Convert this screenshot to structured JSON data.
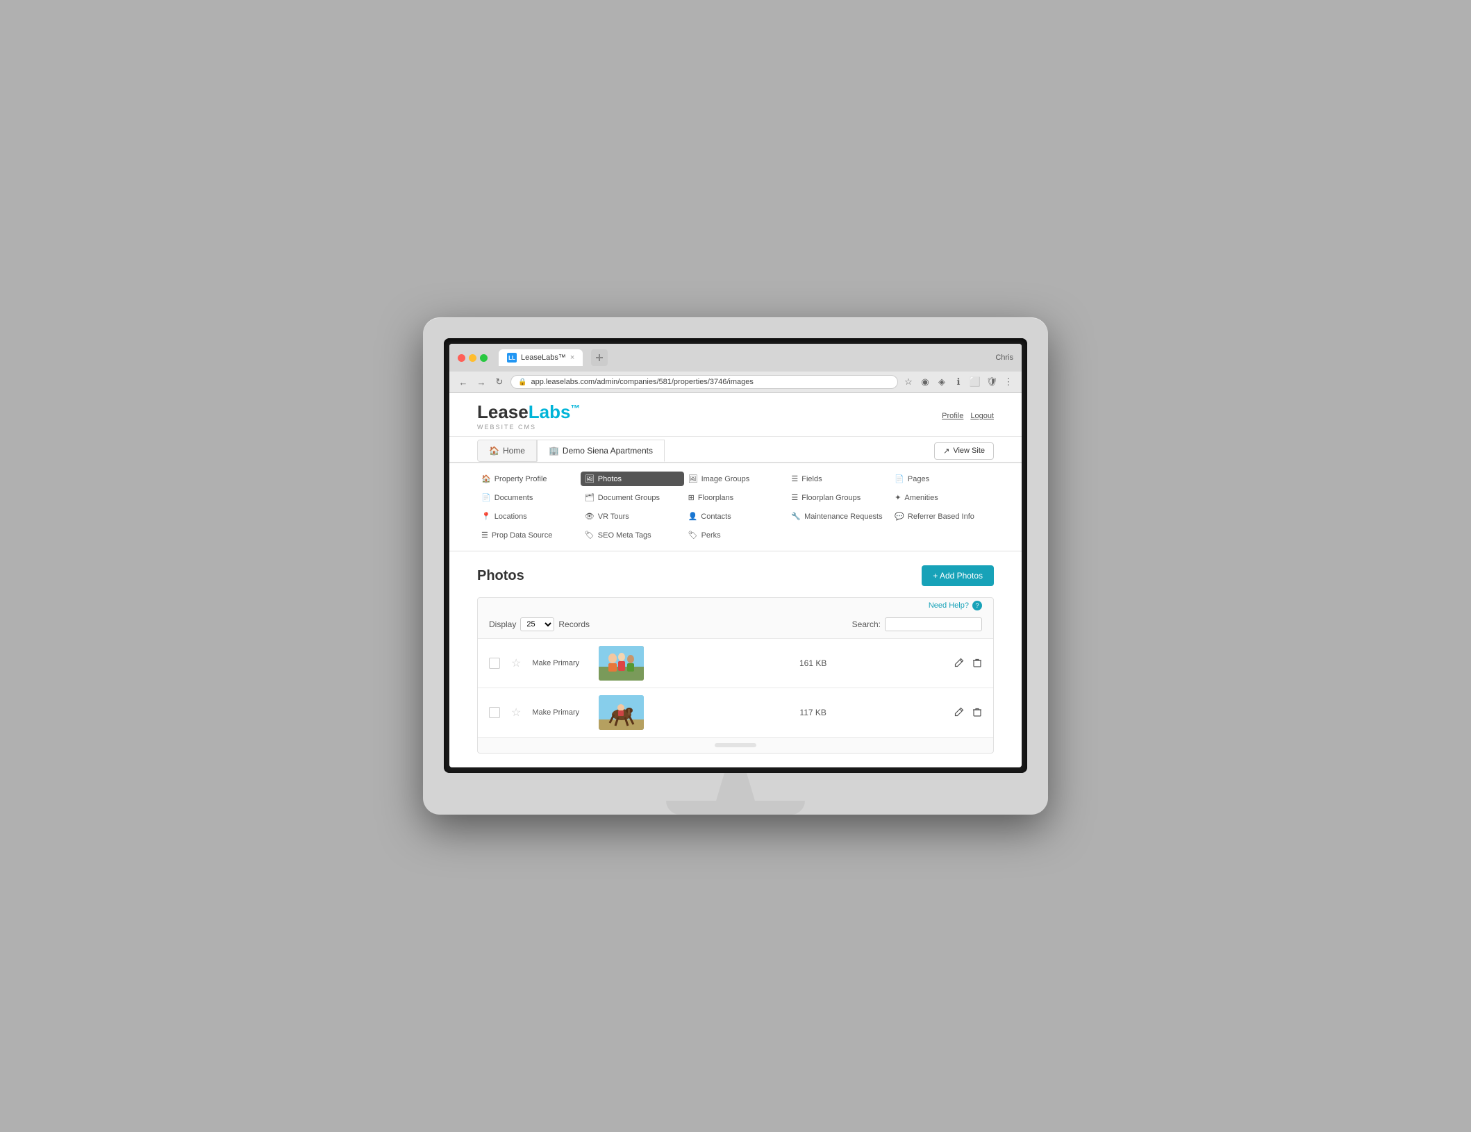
{
  "browser": {
    "tab_title": "LeaseLabs™",
    "tab_close": "×",
    "url": "app.leaselabs.com/admin/companies/581/properties/3746/images",
    "user_label": "Chris"
  },
  "header": {
    "logo_lease": "Lease",
    "logo_labs": "Labs",
    "logo_mark": "™",
    "logo_subtitle": "WEBSITE CMS",
    "nav_profile": "Profile",
    "nav_logout": "Logout"
  },
  "top_tabs": {
    "home_tab": "Home",
    "property_tab": "Demo Siena Apartments",
    "view_site_btn": "View Site"
  },
  "sub_nav": {
    "items": [
      {
        "label": "Property Profile",
        "icon": "🏠",
        "active": false
      },
      {
        "label": "Photos",
        "icon": "🖼",
        "active": true
      },
      {
        "label": "Image Groups",
        "icon": "🖼",
        "active": false
      },
      {
        "label": "Fields",
        "icon": "☰",
        "active": false
      },
      {
        "label": "Pages",
        "icon": "📄",
        "active": false
      },
      {
        "label": "Documents",
        "icon": "📄",
        "active": false
      },
      {
        "label": "Document Groups",
        "icon": "🗂",
        "active": false
      },
      {
        "label": "Floorplans",
        "icon": "⊞",
        "active": false
      },
      {
        "label": "Floorplan Groups",
        "icon": "☰",
        "active": false
      },
      {
        "label": "Amenities",
        "icon": "✦",
        "active": false
      },
      {
        "label": "Locations",
        "icon": "📍",
        "active": false
      },
      {
        "label": "VR Tours",
        "icon": "👁",
        "active": false
      },
      {
        "label": "Contacts",
        "icon": "👤",
        "active": false
      },
      {
        "label": "Maintenance Requests",
        "icon": "🔧",
        "active": false
      },
      {
        "label": "Referrer Based Info",
        "icon": "💬",
        "active": false
      },
      {
        "label": "Prop Data Source",
        "icon": "☰",
        "active": false
      },
      {
        "label": "SEO Meta Tags",
        "icon": "🏷",
        "active": false
      },
      {
        "label": "Perks",
        "icon": "🏷",
        "active": false
      }
    ]
  },
  "page": {
    "title": "Photos",
    "add_button": "+ Add Photos",
    "need_help": "Need Help?",
    "display_label": "Display",
    "display_value": "25",
    "records_label": "Records",
    "search_label": "Search:",
    "search_placeholder": ""
  },
  "photos": [
    {
      "id": 1,
      "make_primary": "Make Primary",
      "file_size": "161 KB",
      "type": "people"
    },
    {
      "id": 2,
      "make_primary": "Make Primary",
      "file_size": "117 KB",
      "type": "horse"
    }
  ]
}
